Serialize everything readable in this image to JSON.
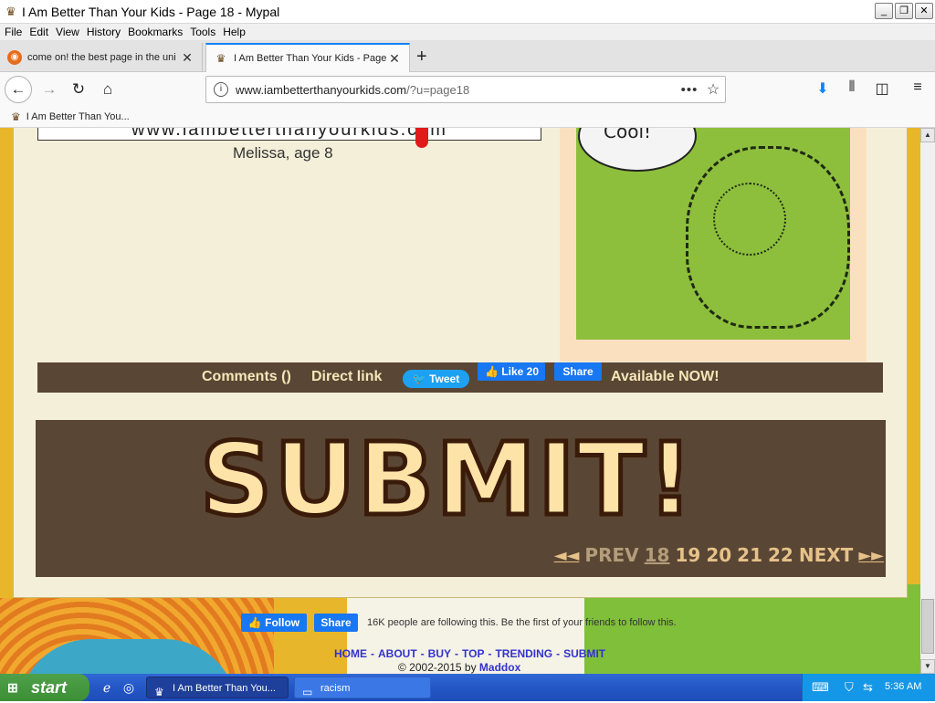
{
  "window": {
    "title": "I Am Better Than Your Kids - Page 18 - Mypal",
    "app_icon": "crown-icon",
    "buttons": [
      "_",
      "❐",
      "✕"
    ]
  },
  "menu": [
    "File",
    "Edit",
    "View",
    "History",
    "Bookmarks",
    "Tools",
    "Help"
  ],
  "tabs": [
    {
      "label": "come on! the best page in the uni",
      "icon": "firefox-icon",
      "active": false
    },
    {
      "label": "I Am Better Than Your Kids - Page",
      "icon": "crown-icon",
      "active": true
    }
  ],
  "nav": {
    "url_host": "www.iambetterthanyourkids.com",
    "url_path": "/?u=page18"
  },
  "bookmarks": [
    {
      "label": "I Am Better Than You..."
    }
  ],
  "page": {
    "caption_text": "www.iambetterthanyourkids.com",
    "author": "Melissa, age 8",
    "bubble_text": "Cool!",
    "share_bar": {
      "comments": "Comments ()",
      "direct_link": "Direct link",
      "tweet": "Tweet",
      "like": "Like 20",
      "share": "Share",
      "available": "Available NOW!"
    },
    "submit_banner": "SUBMIT!",
    "pager": {
      "prev_arrows": "◄◄",
      "prev": "PREV",
      "current": "18",
      "pages": [
        "19",
        "20",
        "21",
        "22"
      ],
      "next": "NEXT",
      "next_arrows": "►►"
    },
    "follow": {
      "follow_label": "Follow",
      "share_label": "Share",
      "text": "16K people are following this. Be the first of your friends to follow this."
    },
    "footer_links": [
      "HOME",
      "ABOUT",
      "BUY",
      "TOP",
      "TRENDING",
      "SUBMIT"
    ],
    "copyright_prefix": "© 2002-2015 by",
    "copyright_name": "Maddox"
  },
  "taskbar": {
    "start": "start",
    "tasks": [
      {
        "label": "I Am Better Than You...",
        "icon": "crown-icon"
      },
      {
        "label": "racism",
        "icon": "folder-icon"
      }
    ],
    "clock": "5:36 AM"
  },
  "colors": {
    "panel_bg": "#f4efd9",
    "bar_brown": "#5a4634",
    "submit_fill": "#fde3a7",
    "link_blue": "#3333cc",
    "facebook_blue": "#1877f2",
    "twitter_blue": "#1da1f2"
  }
}
